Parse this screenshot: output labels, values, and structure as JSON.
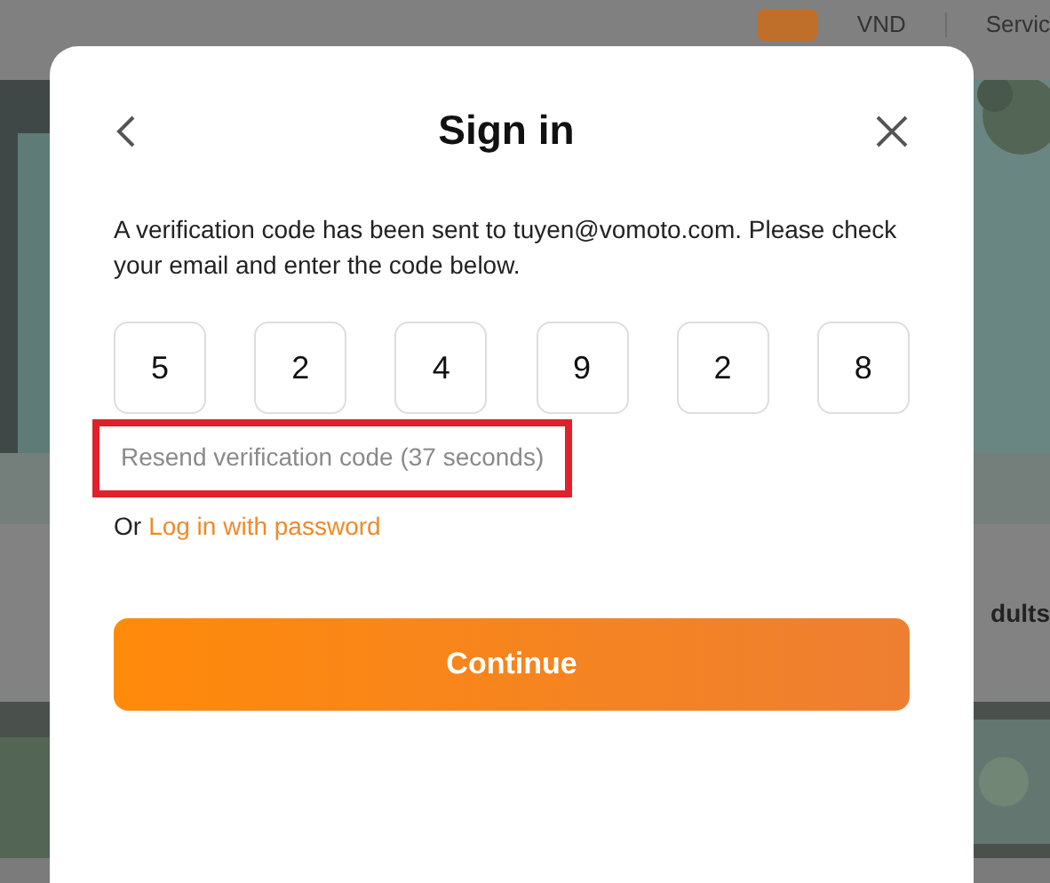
{
  "background": {
    "header": {
      "currency": "VND",
      "menu_item": "Servic"
    },
    "side_text": "dults"
  },
  "dialog": {
    "title": "Sign in",
    "message": "A verification code has been sent to tuyen@vomoto.com. Please check your email and enter the code below.",
    "code_digits": [
      "5",
      "2",
      "4",
      "9",
      "2",
      "8"
    ],
    "resend": {
      "text": "Resend verification code (37 seconds)",
      "disabled": true,
      "highlighted": true
    },
    "alternative": {
      "prefix": "Or",
      "link": "Log in with password"
    },
    "continue_button": "Continue"
  }
}
